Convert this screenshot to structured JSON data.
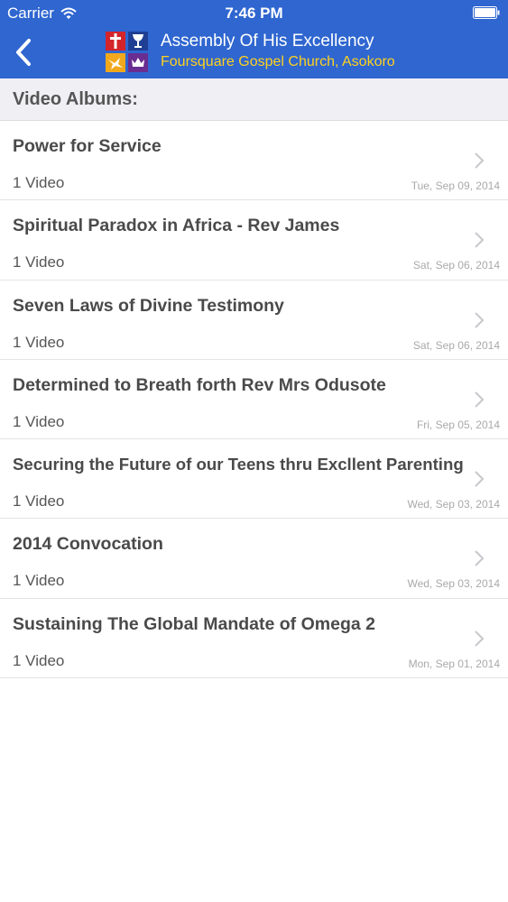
{
  "status_bar": {
    "carrier": "Carrier",
    "time": "7:46 PM",
    "wifi_icon": "wifi-icon",
    "battery_icon": "battery-icon"
  },
  "header": {
    "back_icon": "chevron-left-icon",
    "logo_icon": "church-logo",
    "title": "Assembly Of His Excellency",
    "subtitle": "Foursquare Gospel Church, Asokoro",
    "background_color": "#2f66d0",
    "subtitle_color": "#ffd21e"
  },
  "section": {
    "title": "Video Albums:"
  },
  "albums": [
    {
      "title": "Power for Service",
      "count": "1 Video",
      "date": "Tue, Sep 09, 2014"
    },
    {
      "title": "Spiritual Paradox in Africa - Rev James",
      "count": "1 Video",
      "date": "Sat, Sep 06, 2014"
    },
    {
      "title": "Seven Laws of Divine Testimony",
      "count": "1 Video",
      "date": "Sat, Sep 06, 2014"
    },
    {
      "title": "Determined to Breath forth Rev Mrs Odusote",
      "count": "1 Video",
      "date": "Fri, Sep 05, 2014"
    },
    {
      "title": "Securing the Future of our Teens thru Excllent Parenting",
      "count": "1 Video",
      "date": "Wed, Sep 03, 2014"
    },
    {
      "title": "2014 Convocation",
      "count": "1 Video",
      "date": "Wed, Sep 03, 2014"
    },
    {
      "title": "Sustaining The Global Mandate of Omega 2",
      "count": "1 Video",
      "date": "Mon, Sep 01, 2014"
    }
  ]
}
